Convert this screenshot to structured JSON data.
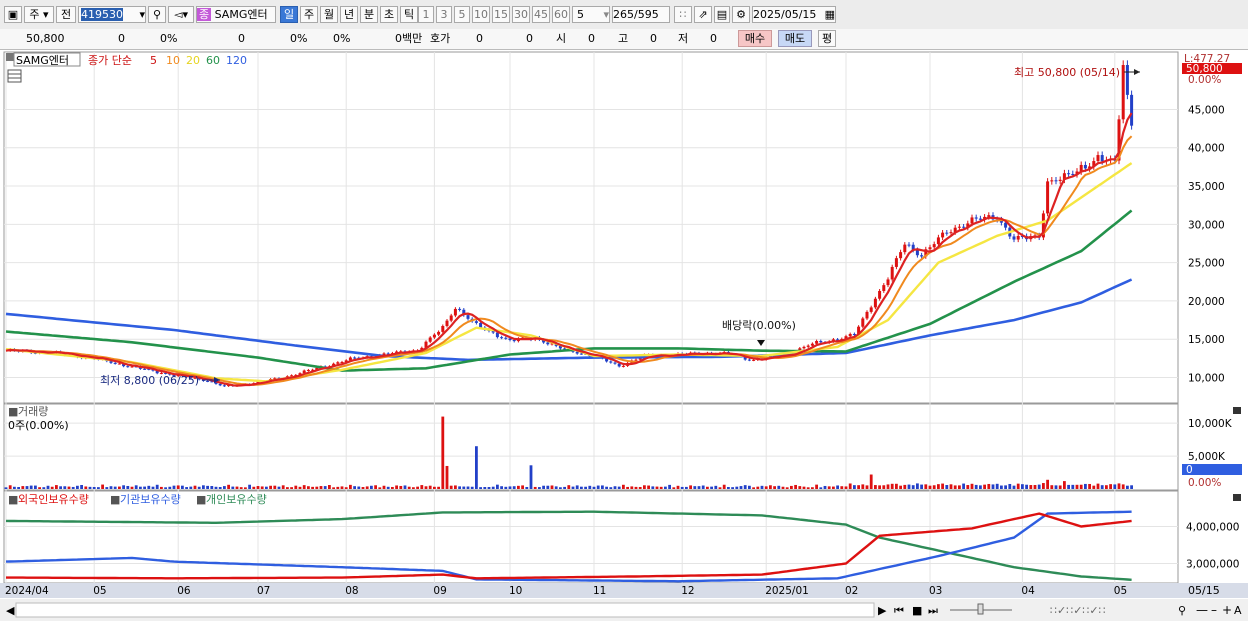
{
  "toolbar": {
    "period_select": "주",
    "market_select": "전",
    "code_value": "419530",
    "stock_badge": "종",
    "stock_name": "SAMG엔터",
    "timeframes": [
      "일",
      "주",
      "월",
      "년",
      "분",
      "초",
      "틱"
    ],
    "active_timeframe": "일",
    "intervals": [
      "1",
      "3",
      "5",
      "10",
      "15",
      "30",
      "45",
      "60"
    ],
    "interval_select": "5",
    "count_value": "265",
    "count_total": "/595",
    "date_value": "2025/05/15"
  },
  "info": {
    "price": "50,800",
    "change": "0",
    "change_pct": "0%",
    "volume": "0",
    "pct2": "0%",
    "pct3": "0%",
    "amount": "0백만",
    "quote_label": "호가",
    "quote_v1": "0",
    "quote_v2": "0",
    "open_label": "시",
    "open_val": "0",
    "high_label": "고",
    "high_val": "0",
    "low_label": "저",
    "low_val": "0",
    "buy_button": "매수",
    "sell_button": "매도",
    "eval_button": "평"
  },
  "price_panel": {
    "stock_label": "SAMG엔터",
    "ma_label": "종가 단순",
    "ma_periods": [
      "5",
      "10",
      "20",
      "60",
      "120"
    ],
    "ma_colors": [
      "#dd2222",
      "#f08a1e",
      "#f5e642",
      "#23924b",
      "#2f5ee0"
    ],
    "axis_top_label": "L:477.27",
    "axis_pct_label": "0.00%",
    "current_price_tag": "50,800",
    "y_ticks": [
      "45,000",
      "40,000",
      "35,000",
      "30,000",
      "25,000",
      "20,000",
      "15,000",
      "10,000"
    ],
    "high_annotation": "최고 50,800 (05/14)",
    "low_annotation": "최저 8,800 (06/25)",
    "dividend_annotation": "배당락(0.00%)"
  },
  "volume_panel": {
    "label": "거래량",
    "value_label": "0주(0.00%)",
    "y_ticks": [
      "10,000K",
      "5,000K"
    ],
    "current_tag": "0",
    "pct_label": "0.00%"
  },
  "holdings_panel": {
    "legend": [
      "외국인보유수량",
      "기관보유수량",
      "개인보유수량"
    ],
    "legend_colors": [
      "#dd1111",
      "#2f5ee0",
      "#2e8b57"
    ],
    "y_ticks": [
      "4,000,000",
      "3,000,000"
    ]
  },
  "x_axis": {
    "labels": [
      "2024/04",
      "05",
      "06",
      "07",
      "08",
      "09",
      "10",
      "11",
      "12",
      "2025/01",
      "02",
      "03",
      "04",
      "05"
    ],
    "right_label": "05/15"
  },
  "chart_data": {
    "type": "line",
    "price_range": [
      6800,
      52500
    ],
    "volume_range_k": [
      0,
      12000
    ],
    "holdings_range": [
      2500000,
      4500000
    ],
    "months": [
      "2024/04",
      "05",
      "06",
      "07",
      "08",
      "09",
      "10",
      "11",
      "12",
      "2025/01",
      "02",
      "03",
      "04",
      "05"
    ],
    "month_positions": [
      0,
      21,
      41,
      60,
      81,
      102,
      120,
      140,
      161,
      181,
      200,
      220,
      242,
      264
    ],
    "close": [
      {
        "i": 0,
        "v": 13500
      },
      {
        "i": 10,
        "v": 13300
      },
      {
        "i": 20,
        "v": 12600
      },
      {
        "i": 30,
        "v": 11400
      },
      {
        "i": 40,
        "v": 10300
      },
      {
        "i": 48,
        "v": 9600
      },
      {
        "i": 52,
        "v": 8800
      },
      {
        "i": 58,
        "v": 9200
      },
      {
        "i": 66,
        "v": 10000
      },
      {
        "i": 74,
        "v": 11200
      },
      {
        "i": 82,
        "v": 12400
      },
      {
        "i": 90,
        "v": 13000
      },
      {
        "i": 98,
        "v": 13600
      },
      {
        "i": 104,
        "v": 16500
      },
      {
        "i": 107,
        "v": 19200
      },
      {
        "i": 112,
        "v": 16800
      },
      {
        "i": 120,
        "v": 14800
      },
      {
        "i": 126,
        "v": 15200
      },
      {
        "i": 132,
        "v": 13800
      },
      {
        "i": 140,
        "v": 12800
      },
      {
        "i": 146,
        "v": 11500
      },
      {
        "i": 152,
        "v": 12800
      },
      {
        "i": 160,
        "v": 13000
      },
      {
        "i": 170,
        "v": 13200
      },
      {
        "i": 178,
        "v": 12300
      },
      {
        "i": 186,
        "v": 13000
      },
      {
        "i": 192,
        "v": 14400
      },
      {
        "i": 198,
        "v": 15000
      },
      {
        "i": 202,
        "v": 15600
      },
      {
        "i": 206,
        "v": 19500
      },
      {
        "i": 210,
        "v": 23000
      },
      {
        "i": 214,
        "v": 27500
      },
      {
        "i": 218,
        "v": 26000
      },
      {
        "i": 224,
        "v": 29000
      },
      {
        "i": 230,
        "v": 30500
      },
      {
        "i": 236,
        "v": 31000
      },
      {
        "i": 240,
        "v": 28000
      },
      {
        "i": 246,
        "v": 28500
      },
      {
        "i": 248,
        "v": 35500
      },
      {
        "i": 252,
        "v": 36000
      },
      {
        "i": 256,
        "v": 37500
      },
      {
        "i": 260,
        "v": 38500
      },
      {
        "i": 264,
        "v": 38000
      },
      {
        "i": 266,
        "v": 50800
      },
      {
        "i": 268,
        "v": 43000
      }
    ],
    "ma20": [
      {
        "i": 0,
        "v": 13700
      },
      {
        "i": 30,
        "v": 12000
      },
      {
        "i": 50,
        "v": 9900
      },
      {
        "i": 62,
        "v": 9500
      },
      {
        "i": 80,
        "v": 11000
      },
      {
        "i": 100,
        "v": 13200
      },
      {
        "i": 112,
        "v": 16500
      },
      {
        "i": 125,
        "v": 15500
      },
      {
        "i": 140,
        "v": 12800
      },
      {
        "i": 160,
        "v": 13000
      },
      {
        "i": 180,
        "v": 12800
      },
      {
        "i": 198,
        "v": 14000
      },
      {
        "i": 210,
        "v": 17500
      },
      {
        "i": 222,
        "v": 25000
      },
      {
        "i": 236,
        "v": 28500
      },
      {
        "i": 248,
        "v": 30500
      },
      {
        "i": 260,
        "v": 35000
      },
      {
        "i": 268,
        "v": 38000
      }
    ],
    "ma60": [
      {
        "i": 0,
        "v": 16000
      },
      {
        "i": 30,
        "v": 14600
      },
      {
        "i": 60,
        "v": 12600
      },
      {
        "i": 80,
        "v": 10900
      },
      {
        "i": 100,
        "v": 11200
      },
      {
        "i": 120,
        "v": 13000
      },
      {
        "i": 140,
        "v": 13800
      },
      {
        "i": 160,
        "v": 13800
      },
      {
        "i": 180,
        "v": 13500
      },
      {
        "i": 200,
        "v": 13400
      },
      {
        "i": 220,
        "v": 17000
      },
      {
        "i": 240,
        "v": 22500
      },
      {
        "i": 256,
        "v": 26500
      },
      {
        "i": 268,
        "v": 31800
      }
    ],
    "ma120": [
      {
        "i": 0,
        "v": 18300
      },
      {
        "i": 40,
        "v": 16200
      },
      {
        "i": 70,
        "v": 14100
      },
      {
        "i": 90,
        "v": 12800
      },
      {
        "i": 110,
        "v": 12300
      },
      {
        "i": 140,
        "v": 12600
      },
      {
        "i": 170,
        "v": 12700
      },
      {
        "i": 200,
        "v": 13200
      },
      {
        "i": 220,
        "v": 15500
      },
      {
        "i": 240,
        "v": 17500
      },
      {
        "i": 256,
        "v": 19800
      },
      {
        "i": 268,
        "v": 22800
      }
    ],
    "volume_spikes_k": [
      {
        "i": 104,
        "v": 11000
      },
      {
        "i": 105,
        "v": 3500
      },
      {
        "i": 112,
        "v": 6500
      },
      {
        "i": 125,
        "v": 3600
      },
      {
        "i": 206,
        "v": 2200
      },
      {
        "i": 248,
        "v": 1400
      },
      {
        "i": 252,
        "v": 1200
      },
      {
        "i": 266,
        "v": 700
      }
    ],
    "foreign_holdings": [
      {
        "i": 0,
        "v": 2620000
      },
      {
        "i": 40,
        "v": 2600000
      },
      {
        "i": 80,
        "v": 2620000
      },
      {
        "i": 104,
        "v": 2700000
      },
      {
        "i": 112,
        "v": 2600000
      },
      {
        "i": 150,
        "v": 2650000
      },
      {
        "i": 180,
        "v": 2700000
      },
      {
        "i": 200,
        "v": 3000000
      },
      {
        "i": 208,
        "v": 3750000
      },
      {
        "i": 230,
        "v": 3950000
      },
      {
        "i": 246,
        "v": 4350000
      },
      {
        "i": 256,
        "v": 4000000
      },
      {
        "i": 268,
        "v": 4150000
      }
    ],
    "institution_holdings": [
      {
        "i": 0,
        "v": 3050000
      },
      {
        "i": 30,
        "v": 3150000
      },
      {
        "i": 40,
        "v": 3050000
      },
      {
        "i": 80,
        "v": 2900000
      },
      {
        "i": 104,
        "v": 2800000
      },
      {
        "i": 112,
        "v": 2570000
      },
      {
        "i": 160,
        "v": 2520000
      },
      {
        "i": 198,
        "v": 2600000
      },
      {
        "i": 210,
        "v": 2900000
      },
      {
        "i": 222,
        "v": 3200000
      },
      {
        "i": 240,
        "v": 3700000
      },
      {
        "i": 248,
        "v": 4350000
      },
      {
        "i": 268,
        "v": 4400000
      }
    ],
    "individual_holdings": [
      {
        "i": 0,
        "v": 4150000
      },
      {
        "i": 50,
        "v": 4100000
      },
      {
        "i": 80,
        "v": 4200000
      },
      {
        "i": 104,
        "v": 4380000
      },
      {
        "i": 140,
        "v": 4400000
      },
      {
        "i": 180,
        "v": 4300000
      },
      {
        "i": 200,
        "v": 4050000
      },
      {
        "i": 208,
        "v": 3700000
      },
      {
        "i": 222,
        "v": 3350000
      },
      {
        "i": 240,
        "v": 2900000
      },
      {
        "i": 256,
        "v": 2650000
      },
      {
        "i": 268,
        "v": 2560000
      }
    ]
  }
}
